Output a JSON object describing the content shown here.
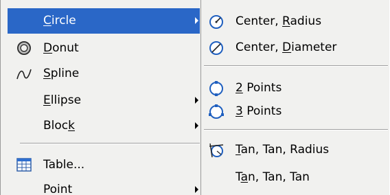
{
  "menu": {
    "items": [
      {
        "pre": "",
        "key": "C",
        "post": "ircle",
        "icon": "",
        "submenu": true,
        "highlighted": true
      },
      {
        "pre": "",
        "key": "D",
        "post": "onut",
        "icon": "donut-icon",
        "submenu": false
      },
      {
        "pre": "",
        "key": "S",
        "post": "pline",
        "icon": "spline-icon",
        "submenu": false
      },
      {
        "pre": "",
        "key": "E",
        "post": "llipse",
        "icon": "",
        "submenu": true
      },
      {
        "pre": "Bloc",
        "key": "k",
        "post": "",
        "icon": "",
        "submenu": true
      },
      {
        "pre": "Table...",
        "key": "",
        "post": "",
        "icon": "table-icon",
        "submenu": false
      },
      {
        "pre": "Point",
        "key": "",
        "post": "",
        "icon": "",
        "submenu": true
      }
    ]
  },
  "submenu": {
    "items": [
      {
        "pre": "Center, ",
        "key": "R",
        "post": "adius",
        "icon": "circle-center-radius-icon"
      },
      {
        "pre": "Center, ",
        "key": "D",
        "post": "iameter",
        "icon": "circle-center-diameter-icon"
      },
      {
        "pre": "",
        "key": "2",
        "post": " Points",
        "icon": "circle-2-points-icon"
      },
      {
        "pre": "",
        "key": "3",
        "post": " Points",
        "icon": "circle-3-points-icon"
      },
      {
        "pre": "",
        "key": "T",
        "post": "an, Tan, Radius",
        "icon": "circle-tan-tan-radius-icon"
      },
      {
        "pre": "T",
        "key": "a",
        "post": "n, Tan, Tan",
        "icon": ""
      }
    ]
  },
  "colors": {
    "highlight": "#2a67c7",
    "menu_background": "#f1f1ef",
    "icon_blue": "#1f5fbf"
  }
}
